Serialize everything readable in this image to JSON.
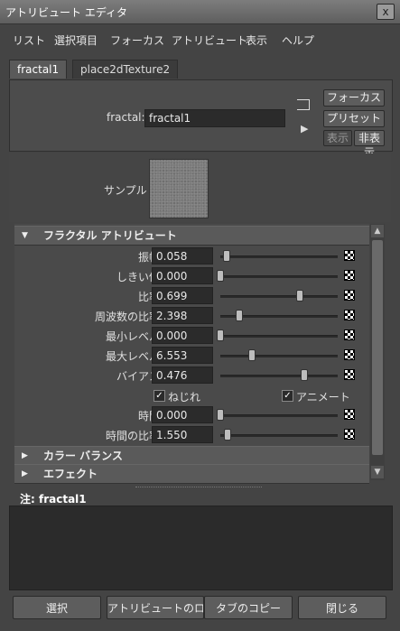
{
  "window": {
    "title": "アトリビュート エディタ",
    "close_glyph": "x"
  },
  "menu": [
    "リスト",
    "選択項目",
    "フォーカス",
    "アトリビュート",
    "表示",
    "ヘルプ"
  ],
  "tabs": [
    {
      "label": "fractal1",
      "active": true
    },
    {
      "label": "place2dTexture2",
      "active": false
    }
  ],
  "node": {
    "label": "fractal:",
    "value": "fractal1",
    "buttons": {
      "focus": "フォーカス",
      "preset": "プリセット",
      "show": "表示",
      "hide": "非表示"
    }
  },
  "sample": {
    "label": "サンプル"
  },
  "section_fractal": {
    "title": "フラクタル アトリビュート",
    "rows": [
      {
        "label": "振幅",
        "value": "0.058",
        "slider": 0.058
      },
      {
        "label": "しきい値",
        "value": "0.000",
        "slider": 0.0
      },
      {
        "label": "比率",
        "value": "0.699",
        "slider": 0.699
      },
      {
        "label": "周波数の比率",
        "value": "2.398",
        "slider": 0.17
      },
      {
        "label": "最小レベル",
        "value": "0.000",
        "slider": 0.0
      },
      {
        "label": "最大レベル",
        "value": "6.553",
        "slider": 0.28
      },
      {
        "label": "バイアス",
        "value": "0.476",
        "slider": 0.74
      }
    ],
    "checkboxes": [
      {
        "label": "ねじれ",
        "checked": true
      },
      {
        "label": "アニメート",
        "checked": true
      }
    ],
    "time_rows": [
      {
        "label": "時間",
        "value": "0.000",
        "slider": 0.0
      },
      {
        "label": "時間の比率",
        "value": "1.550",
        "slider": 0.06
      }
    ]
  },
  "sections_collapsed": [
    "カラー バランス",
    "エフェクト"
  ],
  "notes": {
    "label": "注:  fractal1"
  },
  "footer": [
    "選択",
    "アトリビュートのロー",
    "タブのコピー",
    "閉じる"
  ]
}
